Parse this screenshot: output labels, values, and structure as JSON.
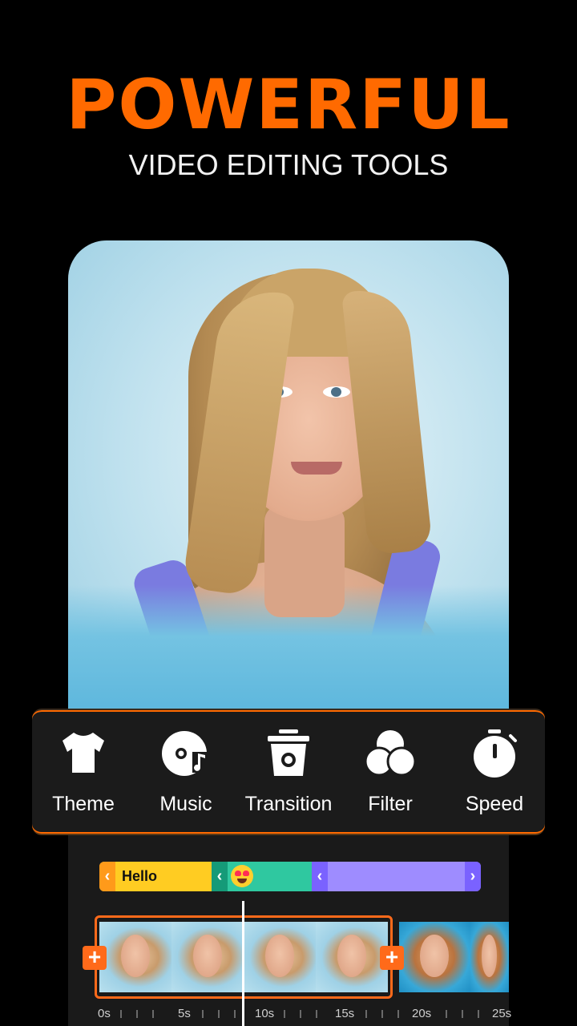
{
  "headline": {
    "title": "POWERFUL",
    "subtitle": "VIDEO EDITING TOOLS"
  },
  "colors": {
    "accent": "#ff6a00",
    "background": "#000000",
    "toolbar_bg": "#1b1b1b"
  },
  "tools": [
    {
      "label": "Theme",
      "icon": "tshirt-icon"
    },
    {
      "label": "Music",
      "icon": "music-disc-icon"
    },
    {
      "label": "Transition",
      "icon": "transition-icon"
    },
    {
      "label": "Filter",
      "icon": "filter-circles-icon"
    },
    {
      "label": "Speed",
      "icon": "stopwatch-icon"
    }
  ],
  "timeline": {
    "text_track": {
      "label": "Hello",
      "sticker": "heart-eyes-emoji"
    },
    "ruler": [
      "0s",
      "5s",
      "10s",
      "15s",
      "20s",
      "25s"
    ]
  }
}
